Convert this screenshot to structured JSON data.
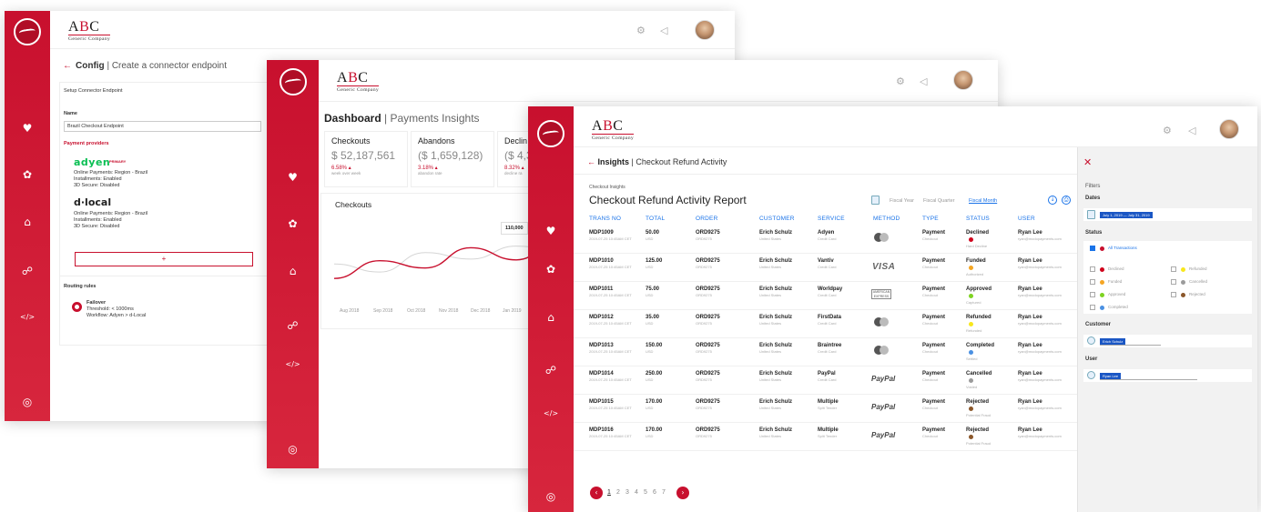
{
  "brand": {
    "name_a": "A",
    "name_b": "B",
    "name_c": "C",
    "tagline": "Generic Company"
  },
  "icons": {
    "logo": "wave-logo-icon",
    "heart": "heart-icon",
    "gear": "gear-icon",
    "inbox": "inbox-icon",
    "network": "network-icon",
    "code": "code-icon",
    "support": "lifebuoy-icon",
    "settings": "settings-icon",
    "notify": "megaphone-icon",
    "back": "arrow-left-icon"
  },
  "glyphs": {
    "heart": "♥",
    "gear": "✿",
    "inbox": "⌂",
    "network": "☍",
    "code": "</>",
    "support": "◎",
    "settings": "⚙",
    "notify": "◁",
    "back": "←",
    "close": "✕",
    "plus": "+",
    "prev": "‹",
    "next": "›",
    "calendar": "",
    "download": "↓",
    "print": "⎙"
  },
  "colors": {
    "accent": "#c8102e",
    "link": "#1a73e8",
    "adyen": "#0abf53"
  },
  "config": {
    "title_bold": "Config",
    "title_rest": "| Create a connector endpoint",
    "section": "Setup Connector Endpoint",
    "name_label": "Name",
    "name_value": "Brazil Checkout Endpoint",
    "providers_label": "Payment providers",
    "providers": [
      {
        "name": "adyen",
        "badge": "PRIMARY",
        "lines": [
          "Online Payments: Region - Brazil",
          "Installments: Enabled",
          "3D Secure: Disabled"
        ]
      },
      {
        "name": "d·local",
        "lines": [
          "Online Payments: Region - Brazil",
          "Installments: Enabled",
          "3D Secure: Disabled"
        ]
      }
    ],
    "add_label": "+",
    "routing_label": "Routing rules",
    "rule": {
      "name": "Failover",
      "threshold": "Threshold: < 1000ms",
      "workflow": "Workflow: Adyen > d-Local"
    }
  },
  "dashboard": {
    "title_bold": "Dashboard",
    "title_rest": "| Payments Insights",
    "kpis": [
      {
        "title": "Checkouts",
        "value": "$ 52,187,561",
        "delta": "6.58%",
        "caption": "week over week"
      },
      {
        "title": "Abandons",
        "value": "($ 1,659,128)",
        "delta": "3.18%",
        "caption": "abandon rate"
      },
      {
        "title": "Declin",
        "value": "($ 4,3",
        "delta": "8.32%",
        "caption": "decline ra"
      }
    ],
    "chart": {
      "title": "Checkouts",
      "tooltip": "110,000",
      "months": [
        "Aug 2018",
        "Sep 2018",
        "Oct 2018",
        "Nov 2018",
        "Dec 2018",
        "Jan 2019"
      ]
    }
  },
  "chart_data": {
    "type": "line",
    "title": "Checkouts",
    "categories": [
      "Aug 2018",
      "Sep 2018",
      "Oct 2018",
      "Nov 2018",
      "Dec 2018",
      "Jan 2019"
    ],
    "series": [
      {
        "values": [
          60000,
          82000,
          73000,
          98000,
          83000,
          110000
        ]
      },
      {
        "values": [
          78000,
          68000,
          92000,
          84000,
          100000,
          94000
        ]
      }
    ],
    "ylim": [
      40000,
      130000
    ],
    "annotations": [
      "110,000"
    ]
  },
  "insights": {
    "title_bold": "Insights",
    "title_rest": "| Checkout Refund Activity",
    "report_sub": "Checkout Insights",
    "report_title": "Checkout Refund Activity Report",
    "periods": [
      "Fiscal Year",
      "Fiscal Quarter",
      "Fiscal Month"
    ],
    "columns": [
      "TRANS NO",
      "TOTAL",
      "ORDER",
      "CUSTOMER",
      "SERVICE",
      "METHOD",
      "TYPE",
      "STATUS",
      "USER"
    ],
    "rows": [
      {
        "trans": "MDP1009",
        "date": "2019-07-25 10:45AM CET",
        "total": "50.00",
        "cur": "USD",
        "order": "ORD9275",
        "order_sub": "ORD9275",
        "customer": "Erich Schulz",
        "country": "United States",
        "service": "Adyen",
        "svc_sub": "Credit Card",
        "method": "mastercard",
        "type": "Payment",
        "type_sub": "Checkout",
        "status": "Declined",
        "status_sub": "Hard Decline",
        "status_color": "#d0021b",
        "user": "Ryan Lee",
        "email": "ryan@modopayments.com"
      },
      {
        "trans": "MDP1010",
        "date": "2019-07-25 10:45AM CET",
        "total": "125.00",
        "cur": "USD",
        "order": "ORD9275",
        "order_sub": "ORD9275",
        "customer": "Erich Schulz",
        "country": "United States",
        "service": "Vantiv",
        "svc_sub": "Credit Card",
        "method": "visa",
        "type": "Payment",
        "type_sub": "Checkout",
        "status": "Funded",
        "status_sub": "Authorized",
        "status_color": "#f5a623",
        "user": "Ryan Lee",
        "email": "ryan@modopayments.com"
      },
      {
        "trans": "MDP1011",
        "date": "2019-07-25 10:45AM CET",
        "total": "75.00",
        "cur": "USD",
        "order": "ORD9275",
        "order_sub": "ORD9275",
        "customer": "Erich Schulz",
        "country": "United States",
        "service": "Worldpay",
        "svc_sub": "Credit Card",
        "method": "amex",
        "type": "Payment",
        "type_sub": "Checkout",
        "status": "Approved",
        "status_sub": "Captured",
        "status_color": "#7ed321",
        "user": "Ryan Lee",
        "email": "ryan@modopayments.com"
      },
      {
        "trans": "MDP1012",
        "date": "2019-07-25 10:45AM CET",
        "total": "35.00",
        "cur": "USD",
        "order": "ORD9275",
        "order_sub": "ORD9275",
        "customer": "Erich Schulz",
        "country": "United States",
        "service": "FirstData",
        "svc_sub": "Credit Card",
        "method": "mastercard",
        "type": "Payment",
        "type_sub": "Checkout",
        "status": "Refunded",
        "status_sub": "Refunded",
        "status_color": "#f8e71c",
        "user": "Ryan Lee",
        "email": "ryan@modopayments.com"
      },
      {
        "trans": "MDP1013",
        "date": "2019-07-25 10:45AM CET",
        "total": "150.00",
        "cur": "USD",
        "order": "ORD9275",
        "order_sub": "ORD9275",
        "customer": "Erich Schulz",
        "country": "United States",
        "service": "Braintree",
        "svc_sub": "Credit Card",
        "method": "mastercard",
        "type": "Payment",
        "type_sub": "Checkout",
        "status": "Completed",
        "status_sub": "Settled",
        "status_color": "#4a90e2",
        "user": "Ryan Lee",
        "email": "ryan@modopayments.com"
      },
      {
        "trans": "MDP1014",
        "date": "2019-07-25 10:45AM CET",
        "total": "250.00",
        "cur": "USD",
        "order": "ORD9275",
        "order_sub": "ORD9275",
        "customer": "Erich Schulz",
        "country": "United States",
        "service": "PayPal",
        "svc_sub": "Credit Card",
        "method": "paypal",
        "type": "Payment",
        "type_sub": "Checkout",
        "status": "Cancelled",
        "status_sub": "Voided",
        "status_color": "#9b9b9b",
        "user": "Ryan Lee",
        "email": "ryan@modopayments.com"
      },
      {
        "trans": "MDP1015",
        "date": "2019-07-25 10:45AM CET",
        "total": "170.00",
        "cur": "USD",
        "order": "ORD9275",
        "order_sub": "ORD9275",
        "customer": "Erich Schulz",
        "country": "United States",
        "service": "Multiple",
        "svc_sub": "Split Tender",
        "method": "paypal",
        "type": "Payment",
        "type_sub": "Checkout",
        "status": "Rejected",
        "status_sub": "Potential Fraud",
        "status_color": "#8b572a",
        "user": "Ryan Lee",
        "email": "ryan@modopayments.com"
      },
      {
        "trans": "MDP1016",
        "date": "2019-07-25 10:45AM CET",
        "total": "170.00",
        "cur": "USD",
        "order": "ORD9275",
        "order_sub": "ORD9275",
        "customer": "Erich Schulz",
        "country": "United States",
        "service": "Multiple",
        "svc_sub": "Split Tender",
        "method": "paypal",
        "type": "Payment",
        "type_sub": "Checkout",
        "status": "Rejected",
        "status_sub": "Potential Fraud",
        "status_color": "#8b572a",
        "user": "Ryan Lee",
        "email": "ryan@modopayments.com"
      }
    ],
    "pages": [
      "1",
      "2",
      "3",
      "4",
      "5",
      "6",
      "7"
    ],
    "method_labels": {
      "visa": "VISA",
      "paypal": "PayPal",
      "amex": "AMERICAN EXPRESS"
    }
  },
  "filters": {
    "title": "Filters",
    "dates_label": "Dates",
    "dates_value": "July 1, 2019 — July 31, 2019",
    "status_label": "Status",
    "all_label": "All Transactions",
    "statuses": [
      {
        "name": "Declined",
        "color": "#d0021b"
      },
      {
        "name": "Refunded",
        "color": "#f8e71c"
      },
      {
        "name": "Funded",
        "color": "#f5a623"
      },
      {
        "name": "Cancelled",
        "color": "#9b9b9b"
      },
      {
        "name": "Approved",
        "color": "#7ed321"
      },
      {
        "name": "Rejected",
        "color": "#8b572a"
      },
      {
        "name": "Completed",
        "color": "#4a90e2"
      }
    ],
    "customer_label": "Customer",
    "customer_value": "Erich Schulz",
    "user_label": "User",
    "user_value": "Ryan Lee"
  }
}
